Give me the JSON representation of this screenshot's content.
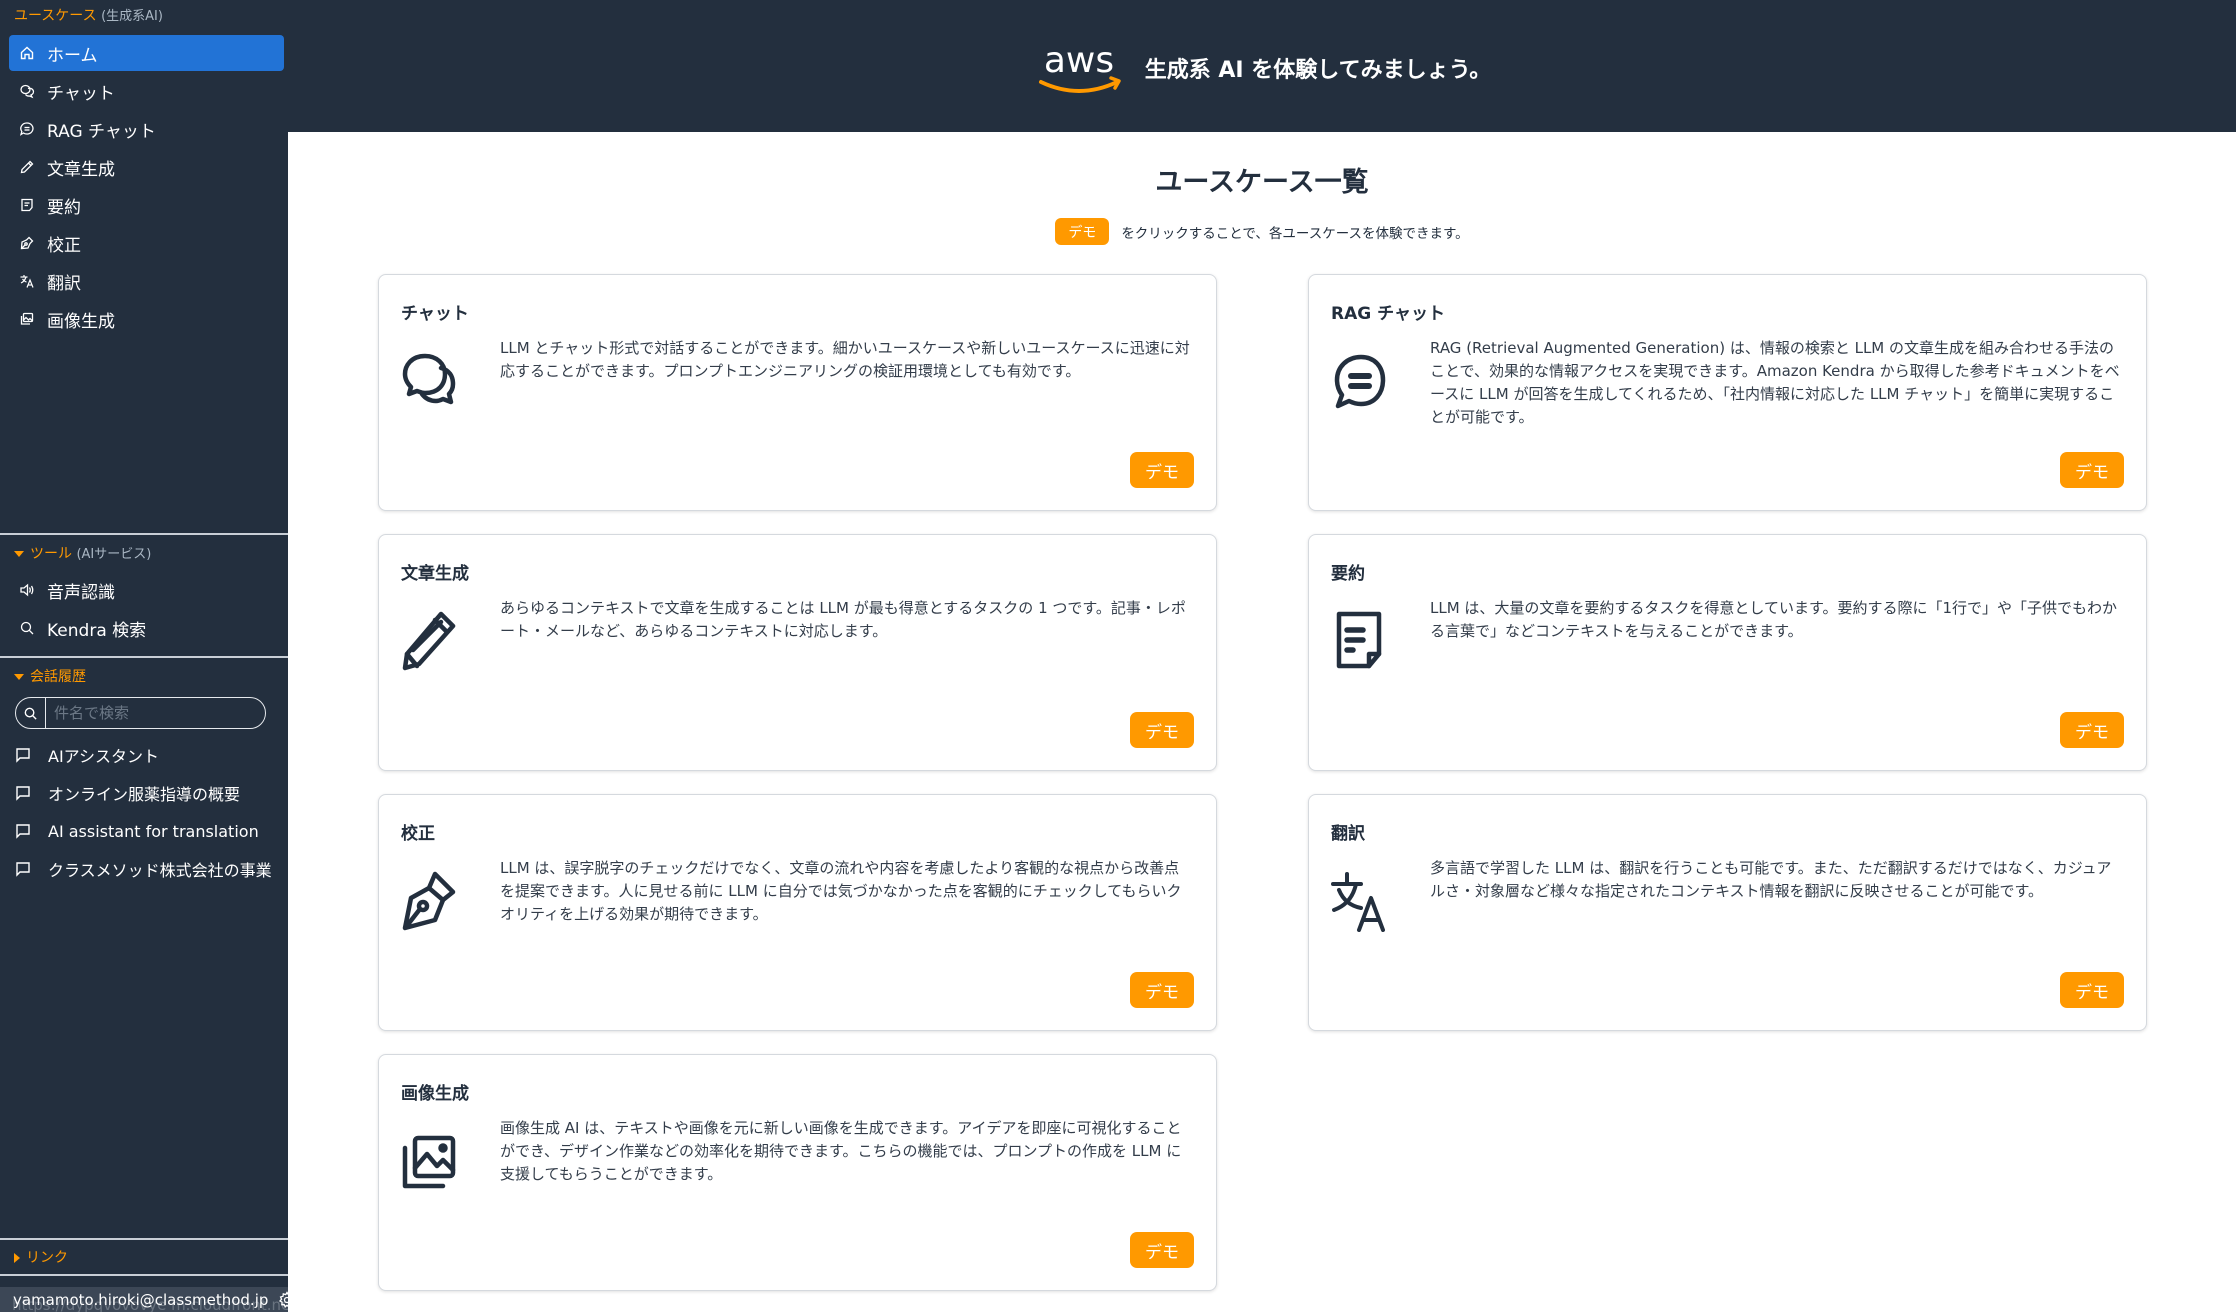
{
  "sidebar": {
    "usecase_section": {
      "title": "ユースケース",
      "subtitle": "(生成系AI)"
    },
    "nav_items": [
      {
        "label": "ホーム",
        "icon": "home-icon",
        "active": true
      },
      {
        "label": "チャット",
        "icon": "chat-bubbles-icon",
        "active": false
      },
      {
        "label": "RAG チャット",
        "icon": "chat-lines-icon",
        "active": false
      },
      {
        "label": "文章生成",
        "icon": "pencil-icon",
        "active": false
      },
      {
        "label": "要約",
        "icon": "document-icon",
        "active": false
      },
      {
        "label": "校正",
        "icon": "pen-nib-icon",
        "active": false
      },
      {
        "label": "翻訳",
        "icon": "translate-icon",
        "active": false
      },
      {
        "label": "画像生成",
        "icon": "images-icon",
        "active": false
      }
    ],
    "tools_section": {
      "title": "ツール",
      "subtitle": "(AIサービス)"
    },
    "tool_items": [
      {
        "label": "音声認識",
        "icon": "speaker-icon"
      },
      {
        "label": "Kendra 検索",
        "icon": "search-icon"
      }
    ],
    "history_section": {
      "title": "会話履歴"
    },
    "history_search": {
      "placeholder": "件名で検索",
      "value": ""
    },
    "history_items": [
      {
        "label": "AIアシスタント"
      },
      {
        "label": "オンライン服薬指導の概要"
      },
      {
        "label": "AI assistant for translation"
      },
      {
        "label": "クラスメソッド株式会社の事業"
      }
    ],
    "links_section": {
      "title": "リンク"
    },
    "footer": {
      "email": "yamamoto.hiroki@classmethod.jp",
      "url_tooltip": "https://dypqvovovye m.cloudfront.net/rag"
    }
  },
  "header": {
    "logo_text": "aws",
    "tagline": "生成系 AI を体験してみましょう。"
  },
  "main": {
    "title": "ユースケース一覧",
    "intro_chip": "デモ",
    "intro_text": "をクリックすることで、各ユースケースを体験できます。",
    "cards": [
      {
        "title": "チャット",
        "icon": "chat-bubbles-icon",
        "description": "LLM とチャット形式で対話することができます。細かいユースケースや新しいユースケースに迅速に対応することができます。プロンプトエンジニアリングの検証用環境としても有効です。",
        "button": "デモ"
      },
      {
        "title": "RAG チャット",
        "icon": "chat-lines-icon",
        "description": "RAG (Retrieval Augmented Generation) は、情報の検索と LLM の文章生成を組み合わせる手法のことで、効果的な情報アクセスを実現できます。Amazon Kendra から取得した参考ドキュメントをベースに LLM が回答を生成してくれるため、「社内情報に対応した LLM チャット」を簡単に実現することが可能です。",
        "button": "デモ"
      },
      {
        "title": "文章生成",
        "icon": "pencil-icon",
        "description": "あらゆるコンテキストで文章を生成することは LLM が最も得意とするタスクの 1 つです。記事・レポート・メールなど、あらゆるコンテキストに対応します。",
        "button": "デモ"
      },
      {
        "title": "要約",
        "icon": "document-icon",
        "description": "LLM は、大量の文章を要約するタスクを得意としています。要約する際に「1行で」や「子供でもわかる言葉で」などコンテキストを与えることができます。",
        "button": "デモ"
      },
      {
        "title": "校正",
        "icon": "pen-nib-icon",
        "description": "LLM は、誤字脱字のチェックだけでなく、文章の流れや内容を考慮したより客観的な視点から改善点を提案できます。人に見せる前に LLM に自分では気づかなかった点を客観的にチェックしてもらいクオリティを上げる効果が期待できます。",
        "button": "デモ"
      },
      {
        "title": "翻訳",
        "icon": "translate-icon",
        "description": "多言語で学習した LLM は、翻訳を行うことも可能です。また、ただ翻訳するだけではなく、カジュアルさ・対象層など様々な指定されたコンテキスト情報を翻訳に反映させることが可能です。",
        "button": "デモ"
      },
      {
        "title": "画像生成",
        "icon": "images-icon",
        "description": "画像生成 AI は、テキストや画像を元に新しい画像を生成できます。アイデアを即座に可視化することができ、デザイン作業などの効率化を期待できます。こちらの機能では、プロンプトの作成を LLM に支援してもらうことができます。",
        "button": "デモ"
      }
    ]
  },
  "colors": {
    "navy": "#232f3e",
    "active_blue": "#2273d6",
    "accent_orange": "#ff9900",
    "card_border": "#d5d9de"
  }
}
